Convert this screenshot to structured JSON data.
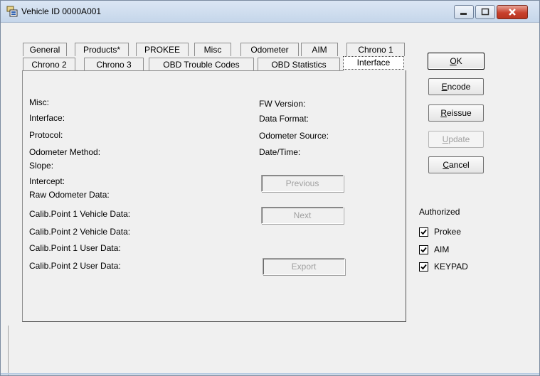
{
  "window": {
    "title": "Vehicle ID 0000A001"
  },
  "tabs": {
    "row1": [
      "General",
      "Products*",
      "PROKEE",
      "Misc",
      "Odometer",
      "AIM",
      "Chrono 1"
    ],
    "row2": [
      "Chrono 2",
      "Chrono 3",
      "OBD Trouble Codes",
      "OBD Statistics",
      "Interface"
    ],
    "active": "Interface"
  },
  "fields_left": {
    "misc": "Misc:",
    "interface": "Interface:",
    "protocol": "Protocol:",
    "odometer_method": "Odometer Method:",
    "slope": "Slope:",
    "intercept": "Intercept:",
    "raw_odometer_data": "Raw Odometer Data:",
    "calib1_vehicle": "Calib.Point 1 Vehicle Data:",
    "calib2_vehicle": "Calib.Point 2 Vehicle Data:",
    "calib1_user": "Calib.Point 1 User Data:",
    "calib2_user": "Calib.Point 2 User Data:"
  },
  "fields_right": {
    "fw_version": "FW Version:",
    "data_format": "Data Format:",
    "odometer_source": "Odometer Source:",
    "date_time": "Date/Time:"
  },
  "panel_buttons": {
    "previous": "Previous",
    "next": "Next",
    "export": "Export"
  },
  "side_buttons": {
    "ok_prefix": "",
    "ok_mnemonic": "O",
    "ok_rest": "K",
    "encode_mnemonic": "E",
    "encode_rest": "ncode",
    "reissue_mnemonic": "R",
    "reissue_rest": "eissue",
    "update_mnemonic": "U",
    "update_rest": "pdate",
    "cancel_mnemonic": "C",
    "cancel_rest": "ancel"
  },
  "authorized": {
    "label": "Authorized",
    "items": [
      {
        "label": "Prokee",
        "checked": true
      },
      {
        "label": "AIM",
        "checked": true
      },
      {
        "label": "KEYPAD",
        "checked": true
      }
    ]
  },
  "colors": {
    "titlebar": "#c5d6ea",
    "close_button": "#c8412d",
    "window_bg": "#f0f0f0"
  }
}
